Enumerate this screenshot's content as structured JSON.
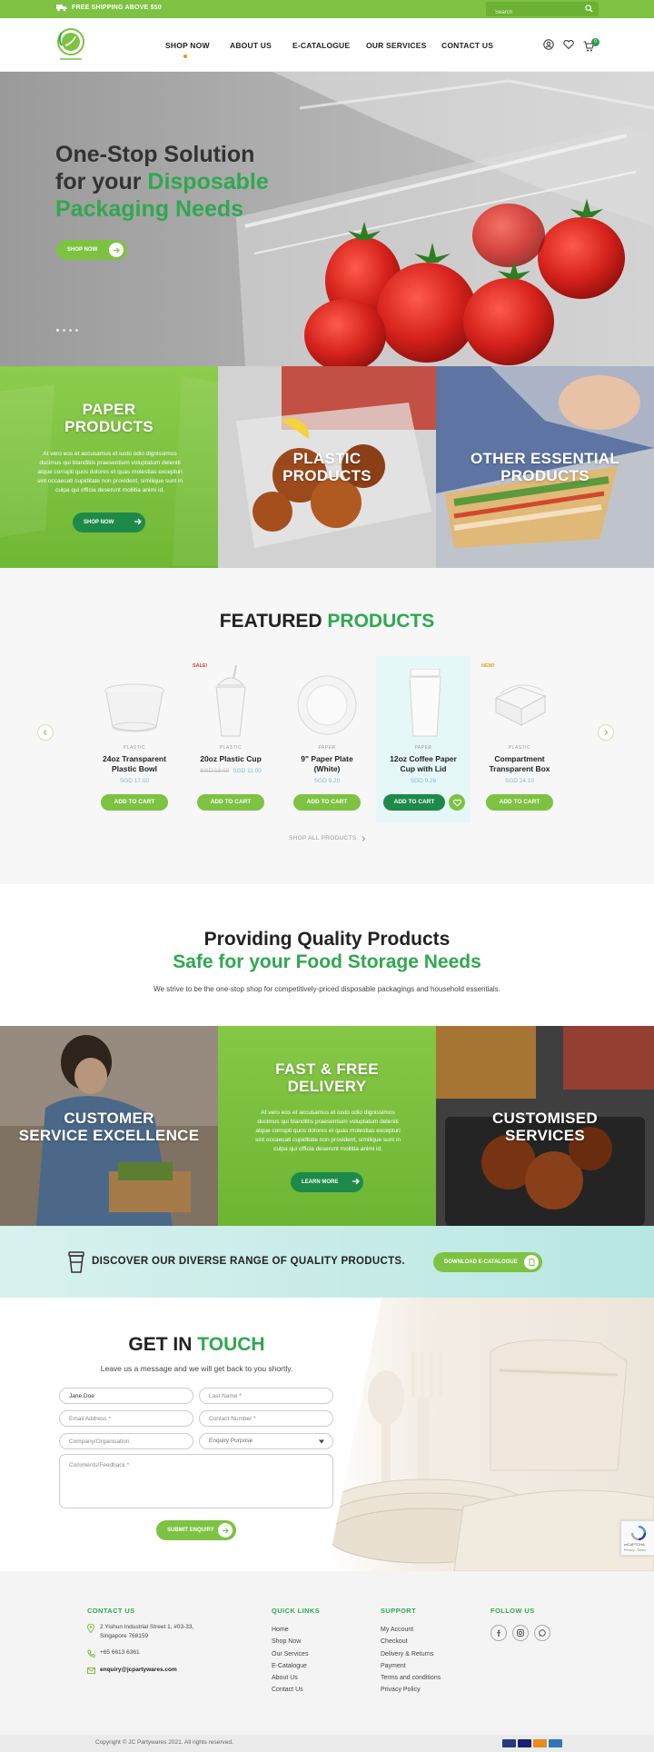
{
  "topbar": {
    "shipping": "FREE SHIPPING ABOVE $50",
    "search_placeholder": "Search"
  },
  "nav": {
    "items": [
      "SHOP NOW",
      "ABOUT US",
      "E-CATALOGUE",
      "OUR SERVICES",
      "CONTACT US"
    ],
    "cart_count": "0"
  },
  "hero": {
    "line1": "One-Stop Solution",
    "line2": "for your",
    "line2_green": "Disposable",
    "line3": "Packaging Needs",
    "cta": "SHOP NOW"
  },
  "categories": {
    "paper": {
      "title_1": "PAPER",
      "title_2": "PRODUCTS",
      "desc": "At vero eos et accusamus et iusto odio dignissimos ducimus qui blanditiis praesentium voluptatum deleniti atque corrupti quos dolores et quas molestias excepturi sint occaecati cupiditate non provident, similique sunt in culpa qui officia deserunt mollitia animi id.",
      "cta": "SHOP NOW"
    },
    "plastic": {
      "title_1": "PLASTIC",
      "title_2": "PRODUCTS"
    },
    "other": {
      "title_1": "OTHER ESSENTIAL",
      "title_2": "PRODUCTS"
    }
  },
  "featured": {
    "title": "FEATURED",
    "title_green": "PRODUCTS",
    "products": [
      {
        "category": "PLASTIC",
        "name_1": "24oz Transparent",
        "name_2": "Plastic Bowl",
        "old_price": "",
        "price": "SGD 17.00",
        "badge": "",
        "cta": "ADD TO CART"
      },
      {
        "category": "PLASTIC",
        "name_1": "20oz Plastic Cup",
        "name_2": "",
        "old_price": "SGD 13.00",
        "price": "SGD 11.00",
        "badge": "SALE!",
        "cta": "ADD TO CART"
      },
      {
        "category": "PAPER",
        "name_1": "9\" Paper Plate",
        "name_2": "(White)",
        "old_price": "",
        "price": "SGD 9.20",
        "badge": "",
        "cta": "ADD TO CART"
      },
      {
        "category": "PAPER",
        "name_1": "12oz Coffee Paper",
        "name_2": "Cup with Lid",
        "old_price": "",
        "price": "SGD 9.26",
        "badge": "",
        "cta": "ADD TO CART"
      },
      {
        "category": "PLASTIC",
        "name_1": "Compartment",
        "name_2": "Transparent Box",
        "old_price": "",
        "price": "SGD 24.10",
        "badge": "NEW!",
        "cta": "ADD TO CART"
      }
    ],
    "shop_all": "SHOP ALL PRODUCTS"
  },
  "quality": {
    "line1": "Providing Quality Products",
    "line2": "Safe for your Food Storage Needs",
    "sub": "We strive to be the one-stop shop for competitively-priced disposable packagings and household essentials."
  },
  "services": {
    "customer": {
      "title_1": "CUSTOMER",
      "title_2": "SERVICE EXCELLENCE"
    },
    "delivery": {
      "title_1": "FAST & FREE",
      "title_2": "DELIVERY",
      "desc": "At vero eos et accusamus et iusto odio dignissimos ducimus qui blanditiis praesentium voluptatum deleniti atque corrupti quos dolores et quas molestias excepturi sint occaecati cupiditate non provident, similique sunt in culpa qui officia deserunt mollitia animi id.",
      "cta": "LEARN MORE"
    },
    "custom": {
      "title_1": "CUSTOMISED",
      "title_2": "SERVICES"
    }
  },
  "discover": {
    "text": "DISCOVER OUR DIVERSE RANGE OF QUALITY PRODUCTS.",
    "cta": "DOWNLOAD E-CATALOGUE"
  },
  "contact": {
    "title": "GET IN",
    "title_green": "TOUCH",
    "sub": "Leave us a message and we will get back to you shortly.",
    "first_name": "Jane Doe",
    "last_name_ph": "Last Name *",
    "email_ph": "Email Address *",
    "phone_ph": "Contact Number *",
    "company_ph": "Company/Organisation",
    "purpose": "Enquiry Purpose",
    "comments_ph": "Comments/Feedback *",
    "submit": "SUBMIT ENQUIRY",
    "recaptcha_1": "reCAPTCHA",
    "recaptcha_2": "Privacy - Terms"
  },
  "footer": {
    "contact_head": "CONTACT US",
    "address_1": "2 Yishun Industrial Street 1, #03-33,",
    "address_2": "Singapore 768159",
    "phone": "+65 6613 6361",
    "email": "enquiry@jcpartywares.com",
    "quick_head": "QUICK LINKS",
    "quick": [
      "Home",
      "Shop Now",
      "Our Services",
      "E-Catalogue",
      "About Us",
      "Contact Us"
    ],
    "support_head": "SUPPORT",
    "support": [
      "My Account",
      "Checkout",
      "Delivery & Returns",
      "Payment",
      "Terms and conditions",
      "Privacy Policy"
    ],
    "follow_head": "FOLLOW US",
    "copyright": "Copyright © JC Partywares 2021. All rights reserved."
  },
  "colors": {
    "brand_green": "#7dc242",
    "dark_green": "#1e8a4a",
    "text_green": "#2fa84f"
  }
}
